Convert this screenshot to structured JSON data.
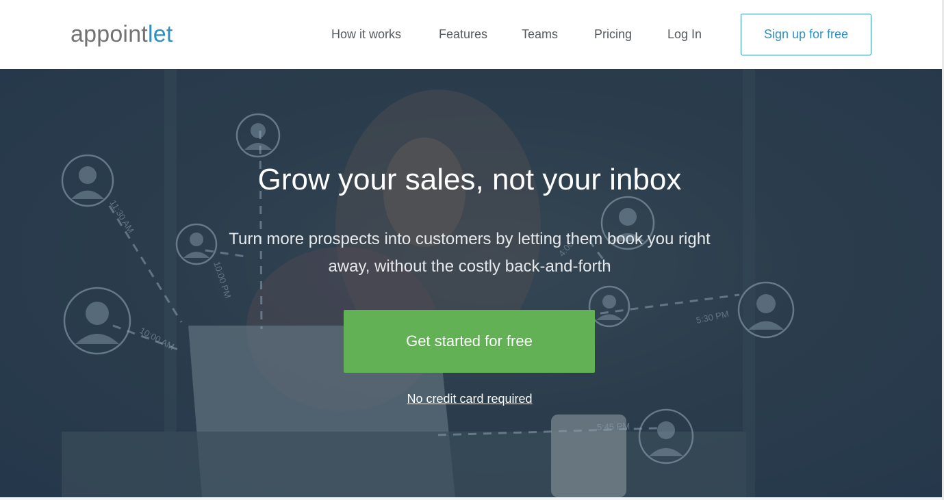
{
  "brand": {
    "logo_main": "appoint",
    "logo_accent": "let"
  },
  "nav": {
    "links": [
      "How it works",
      "Features",
      "Teams",
      "Pricing",
      "Log In"
    ],
    "signup_label": "Sign up for free"
  },
  "hero": {
    "title": "Grow your sales, not your inbox",
    "subtitle": "Turn more prospects into customers by letting them book you right away, without the costly back-and-forth",
    "cta_label": "Get started for free",
    "note_link": "No credit card required",
    "background_times": [
      "11:30 AM",
      "10:00 PM",
      "10:00 AM",
      "5:30 PM",
      "5:45 PM",
      "4:00"
    ]
  },
  "colors": {
    "accent": "#2f8fbf",
    "cta_green": "#62b154",
    "hero_overlay": "#22364a"
  }
}
